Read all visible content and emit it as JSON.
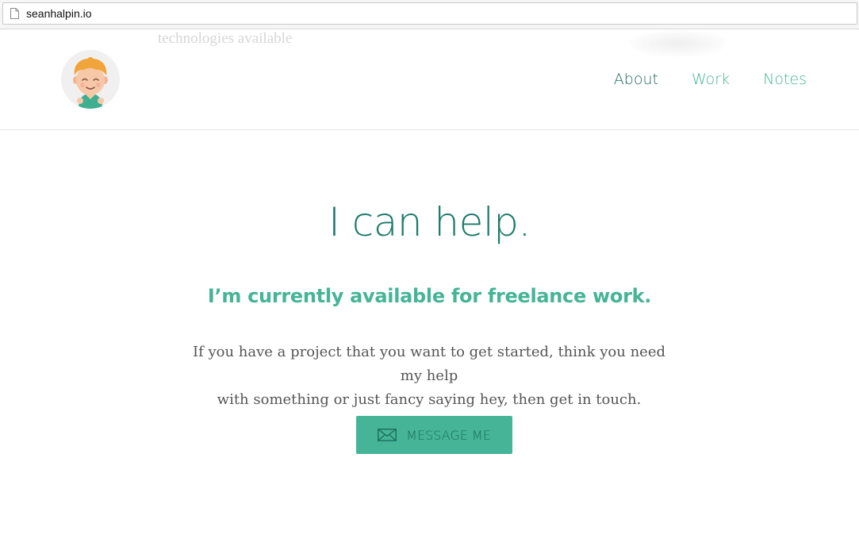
{
  "browser": {
    "url": "seanhalpin.io"
  },
  "background": {
    "ghost_text": "technologies available"
  },
  "header": {
    "avatar_icon": "boy-avatar-icon",
    "nav": [
      {
        "label": "About",
        "active": true
      },
      {
        "label": "Work",
        "active": false
      },
      {
        "label": "Notes",
        "active": false
      }
    ]
  },
  "main": {
    "headline": "I can help.",
    "subheadline": "I’m currently available for freelance work.",
    "body_line1": "If you have a project that you want to get started, think you need my help",
    "body_line2": "with something or just fancy saying hey, then get in touch.",
    "cta": {
      "label": "MESSAGE ME",
      "icon": "envelope-icon"
    }
  },
  "colors": {
    "accent": "#45b497",
    "accent_dark": "#1c7a68",
    "text": "#555555"
  }
}
